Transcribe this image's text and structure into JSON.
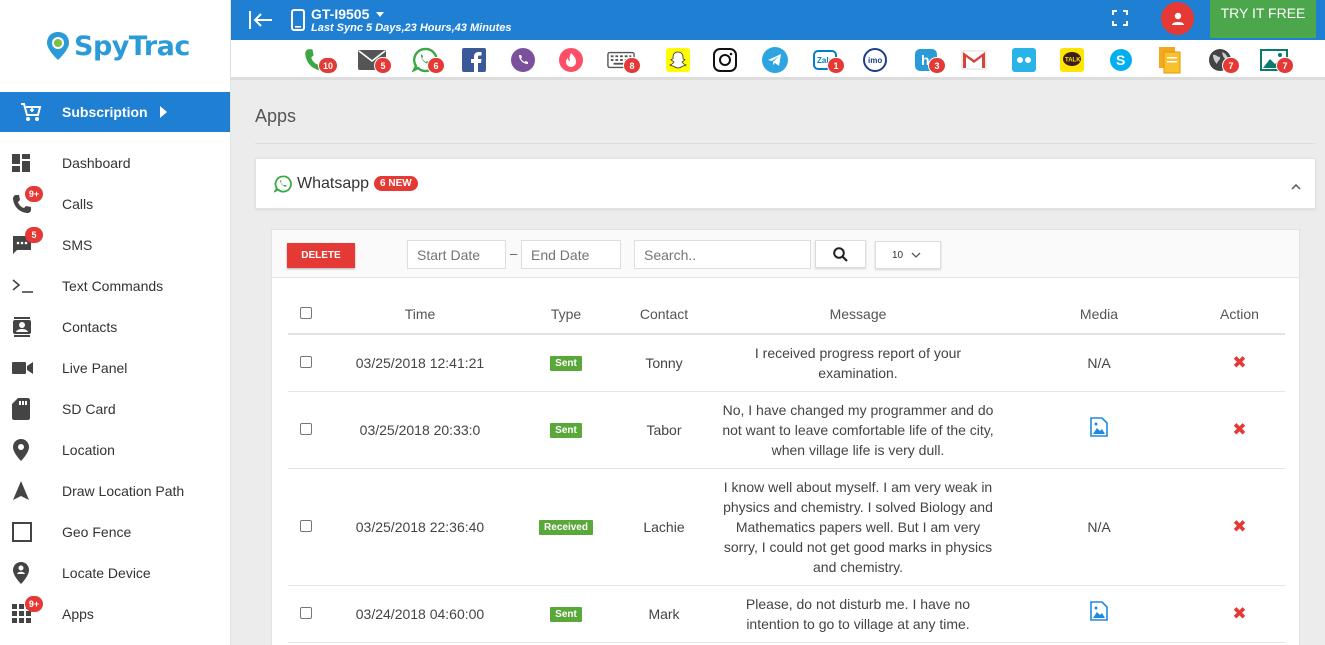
{
  "brand": {
    "name": "SpyTrac"
  },
  "sidebar": {
    "subscription": {
      "label": "Subscription"
    },
    "items": [
      {
        "label": "Dashboard",
        "icon": "dashboard-icon",
        "badge": ""
      },
      {
        "label": "Calls",
        "icon": "phone-icon",
        "badge": "9+"
      },
      {
        "label": "SMS",
        "icon": "sms-icon",
        "badge": "5"
      },
      {
        "label": "Text Commands",
        "icon": "terminal-icon",
        "badge": ""
      },
      {
        "label": "Contacts",
        "icon": "contacts-icon",
        "badge": ""
      },
      {
        "label": "Live Panel",
        "icon": "video-camera-icon",
        "badge": ""
      },
      {
        "label": "SD Card",
        "icon": "sd-card-icon",
        "badge": ""
      },
      {
        "label": "Location",
        "icon": "location-pin-icon",
        "badge": ""
      },
      {
        "label": "Draw Location Path",
        "icon": "navigation-arrow-icon",
        "badge": ""
      },
      {
        "label": "Geo Fence",
        "icon": "square-outline-icon",
        "badge": ""
      },
      {
        "label": "Locate Device",
        "icon": "locate-device-icon",
        "badge": ""
      },
      {
        "label": "Apps",
        "icon": "apps-grid-icon",
        "badge": "9+"
      }
    ]
  },
  "header": {
    "device_name": "GT-I9505",
    "last_sync": "Last Sync 5 Days,23 Hours,43 Minutes",
    "try_free": "TRY IT FREE"
  },
  "appbar": [
    {
      "name": "phone",
      "count": "10"
    },
    {
      "name": "mail",
      "count": "5"
    },
    {
      "name": "whatsapp",
      "count": "6"
    },
    {
      "name": "facebook",
      "count": ""
    },
    {
      "name": "viber",
      "count": ""
    },
    {
      "name": "tinder",
      "count": ""
    },
    {
      "name": "keyboard",
      "count": "8"
    },
    {
      "name": "snapchat",
      "count": ""
    },
    {
      "name": "instagram",
      "count": ""
    },
    {
      "name": "telegram",
      "count": ""
    },
    {
      "name": "zalo",
      "count": "1"
    },
    {
      "name": "imo",
      "count": ""
    },
    {
      "name": "hike",
      "count": "3"
    },
    {
      "name": "gmail",
      "count": ""
    },
    {
      "name": "flickr",
      "count": ""
    },
    {
      "name": "kakaotalk",
      "count": ""
    },
    {
      "name": "skype",
      "count": ""
    },
    {
      "name": "files",
      "count": ""
    },
    {
      "name": "browser",
      "count": "7"
    },
    {
      "name": "gallery",
      "count": "7"
    }
  ],
  "main": {
    "page_title": "Apps",
    "panel": {
      "title": "Whatsapp",
      "new_badge": "6 NEW"
    },
    "toolbar": {
      "delete_label": "DELETE",
      "start_date_placeholder": "Start Date",
      "end_date_placeholder": "End Date",
      "date_separator": "–",
      "search_placeholder": "Search..",
      "page_size": "10"
    },
    "table": {
      "columns": [
        "Time",
        "Type",
        "Contact",
        "Message",
        "Media",
        "Action"
      ],
      "rows": [
        {
          "time": "03/25/2018 12:41:21",
          "type": "Sent",
          "contact": "Tonny",
          "message": "I received progress report of your examination.",
          "media": "N/A"
        },
        {
          "time": "03/25/2018 20:33:0",
          "type": "Sent",
          "contact": "Tabor",
          "message": "No, I have changed my programmer and do not want to leave comfortable life of the city, when village life is very dull.",
          "media": "image"
        },
        {
          "time": "03/25/2018 22:36:40",
          "type": "Received",
          "contact": "Lachie",
          "message": "I know well about myself. I am very weak in physics and chemistry. I solved Biology and Mathematics papers well. But I am very sorry, I could not get good marks in physics and chemistry.",
          "media": "N/A"
        },
        {
          "time": "03/24/2018 04:60:00",
          "type": "Sent",
          "contact": "Mark",
          "message": "Please, do not disturb me. I have no intention to go to village at any time.",
          "media": "image"
        }
      ]
    }
  },
  "colors": {
    "primary_blue": "#1e7fd3",
    "try_free_green": "#4ca64c",
    "badge_red": "#e53935",
    "type_green": "#5aa73a"
  }
}
